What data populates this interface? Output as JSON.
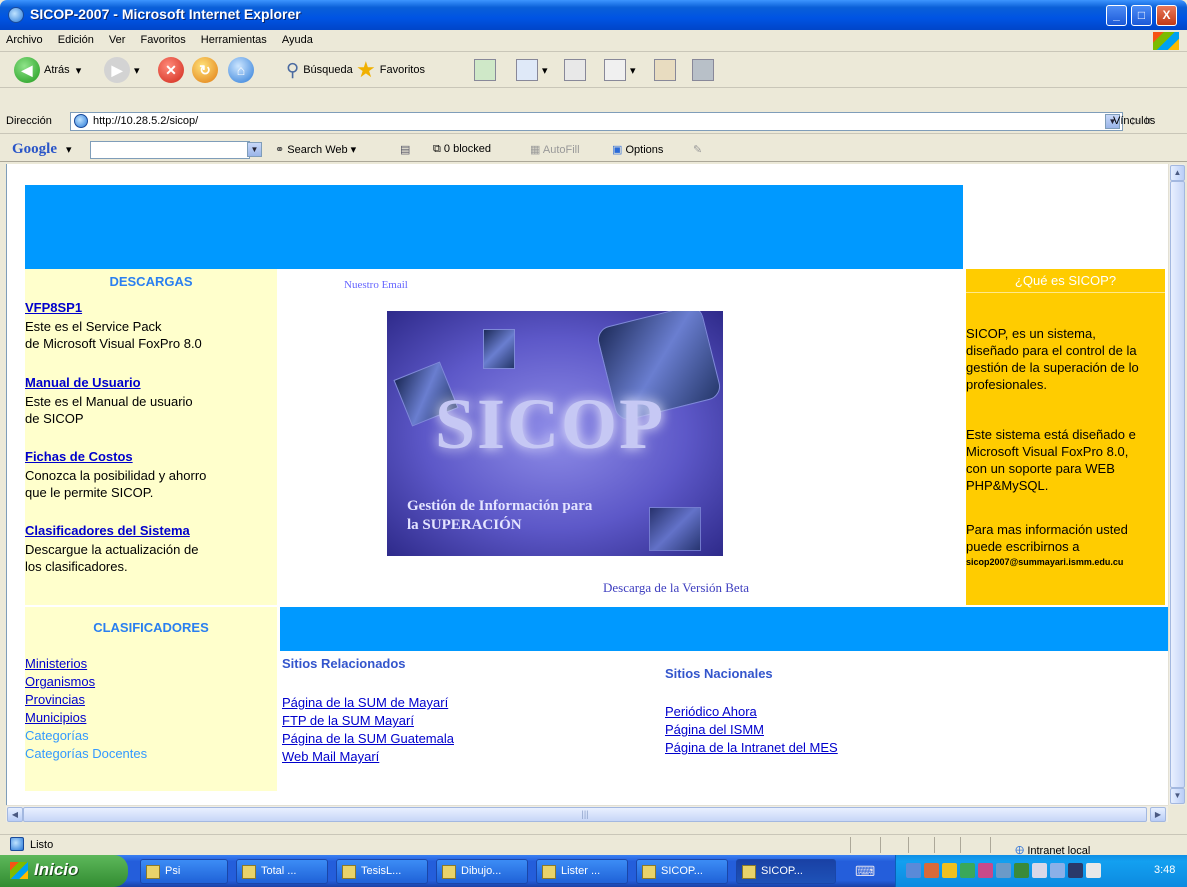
{
  "window": {
    "title": "SICOP-2007 - Microsoft Internet Explorer",
    "btn_min": "_",
    "btn_max": "□",
    "btn_close": "X"
  },
  "menu": [
    "Archivo",
    "Edición",
    "Ver",
    "Favoritos",
    "Herramientas",
    "Ayuda"
  ],
  "toolbar": {
    "back": "Atrás",
    "search": "Búsqueda",
    "favorites": "Favoritos"
  },
  "address": {
    "label": "Dirección",
    "url": "http://10.28.5.2/sicop/",
    "go": "Ir",
    "links": "Vínculos"
  },
  "google_bar": {
    "logo": "Google",
    "search_web": "Search Web",
    "blocked": "0 blocked",
    "autofill": "AutoFill",
    "options": "Options"
  },
  "page": {
    "descargas": {
      "heading": "DESCARGAS",
      "items": [
        {
          "title": "VFP8SP1",
          "desc": "Este es el Service Pack\nde Microsoft Visual FoxPro 8.0"
        },
        {
          "title": "Manual de Usuario",
          "desc": "Este es el Manual de usuario\nde SICOP"
        },
        {
          "title": "Fichas de Costos",
          "desc": "Conozca la posibilidad y ahorro\nque le permite SICOP."
        },
        {
          "title": "Clasificadores del Sistema",
          "desc": "Descargue la actualización de\nlos clasificadores."
        }
      ]
    },
    "email_link": "Nuestro Email",
    "logo": {
      "main": "SICOP",
      "sub": "Gestión de Información para\nla SUPERACIÓN"
    },
    "download_beta": "Descarga de la Versión Beta",
    "about": {
      "heading": "¿Qué es SICOP?",
      "p1": "SICOP, es un sistema,\ndiseñado para el control de la\ngestión de la superación de lo\nprofesionales.",
      "p2": "Este sistema está diseñado e\nMicrosoft Visual FoxPro 8.0,\ncon un soporte para WEB\nPHP&MySQL.",
      "p3": "Para mas información usted\npuede escribirnos a",
      "email": "sicop2007@summayari.ismm.edu.cu"
    },
    "clasificadores": {
      "heading": "CLASIFICADORES",
      "items": [
        "Ministerios",
        "Organismos",
        "Provincias",
        "Municipios",
        "Categorías",
        "Categorías Docentes"
      ]
    },
    "relacionados": {
      "heading": "Sitios Relacionados",
      "links": [
        "Página de la SUM de Mayarí",
        "FTP de la SUM Mayarí",
        "Página de la SUM Guatemala",
        "Web Mail Mayarí"
      ]
    },
    "nacionales": {
      "heading": "Sitios Nacionales",
      "links": [
        "Periódico Ahora",
        "Página del ISMM",
        "Página de la Intranet del MES"
      ]
    }
  },
  "status": {
    "text": "Listo",
    "zone": "Intranet local"
  },
  "taskbar": {
    "start": "Inicio",
    "tasks": [
      "Psi",
      "Total ...",
      "TesisL...",
      "Dibujo...",
      "Lister ...",
      "SICOP...",
      "SICOP..."
    ],
    "clock": "3:48"
  }
}
